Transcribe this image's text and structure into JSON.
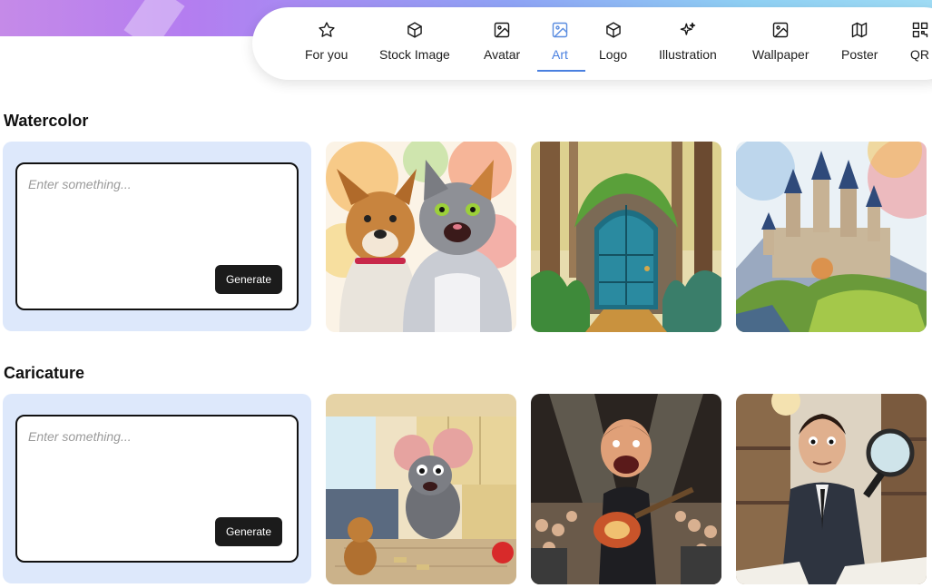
{
  "nav": {
    "items": [
      {
        "label": "For you",
        "icon": "star-icon"
      },
      {
        "label": "Stock Image",
        "icon": "cube-icon"
      },
      {
        "label": "Avatar",
        "icon": "image-icon"
      },
      {
        "label": "Art",
        "icon": "image-icon"
      },
      {
        "label": "Logo",
        "icon": "cube-icon"
      },
      {
        "label": "Illustration",
        "icon": "sparkles-icon"
      },
      {
        "label": "Wallpaper",
        "icon": "image-icon"
      },
      {
        "label": "Poster",
        "icon": "map-icon"
      },
      {
        "label": "QR",
        "icon": "qr-icon"
      }
    ],
    "active": "Art",
    "accent_color": "#4a80e0"
  },
  "sections": [
    {
      "title": "Watercolor",
      "prompt": {
        "placeholder": "Enter something...",
        "value": "",
        "button_label": "Generate"
      },
      "images": [
        "dog-and-cat-watercolor-image",
        "forest-door-watercolor-image",
        "castle-watercolor-image"
      ]
    },
    {
      "title": "Caricature",
      "prompt": {
        "placeholder": "Enter something...",
        "value": "",
        "button_label": "Generate"
      },
      "images": [
        "mouse-in-kitchen-caricature-image",
        "guitarist-on-stage-caricature-image",
        "detective-with-magnifier-caricature-image"
      ]
    }
  ],
  "colors": {
    "prompt_card_bg": "#dde8fb",
    "generate_button_bg": "#1b1b1b"
  }
}
